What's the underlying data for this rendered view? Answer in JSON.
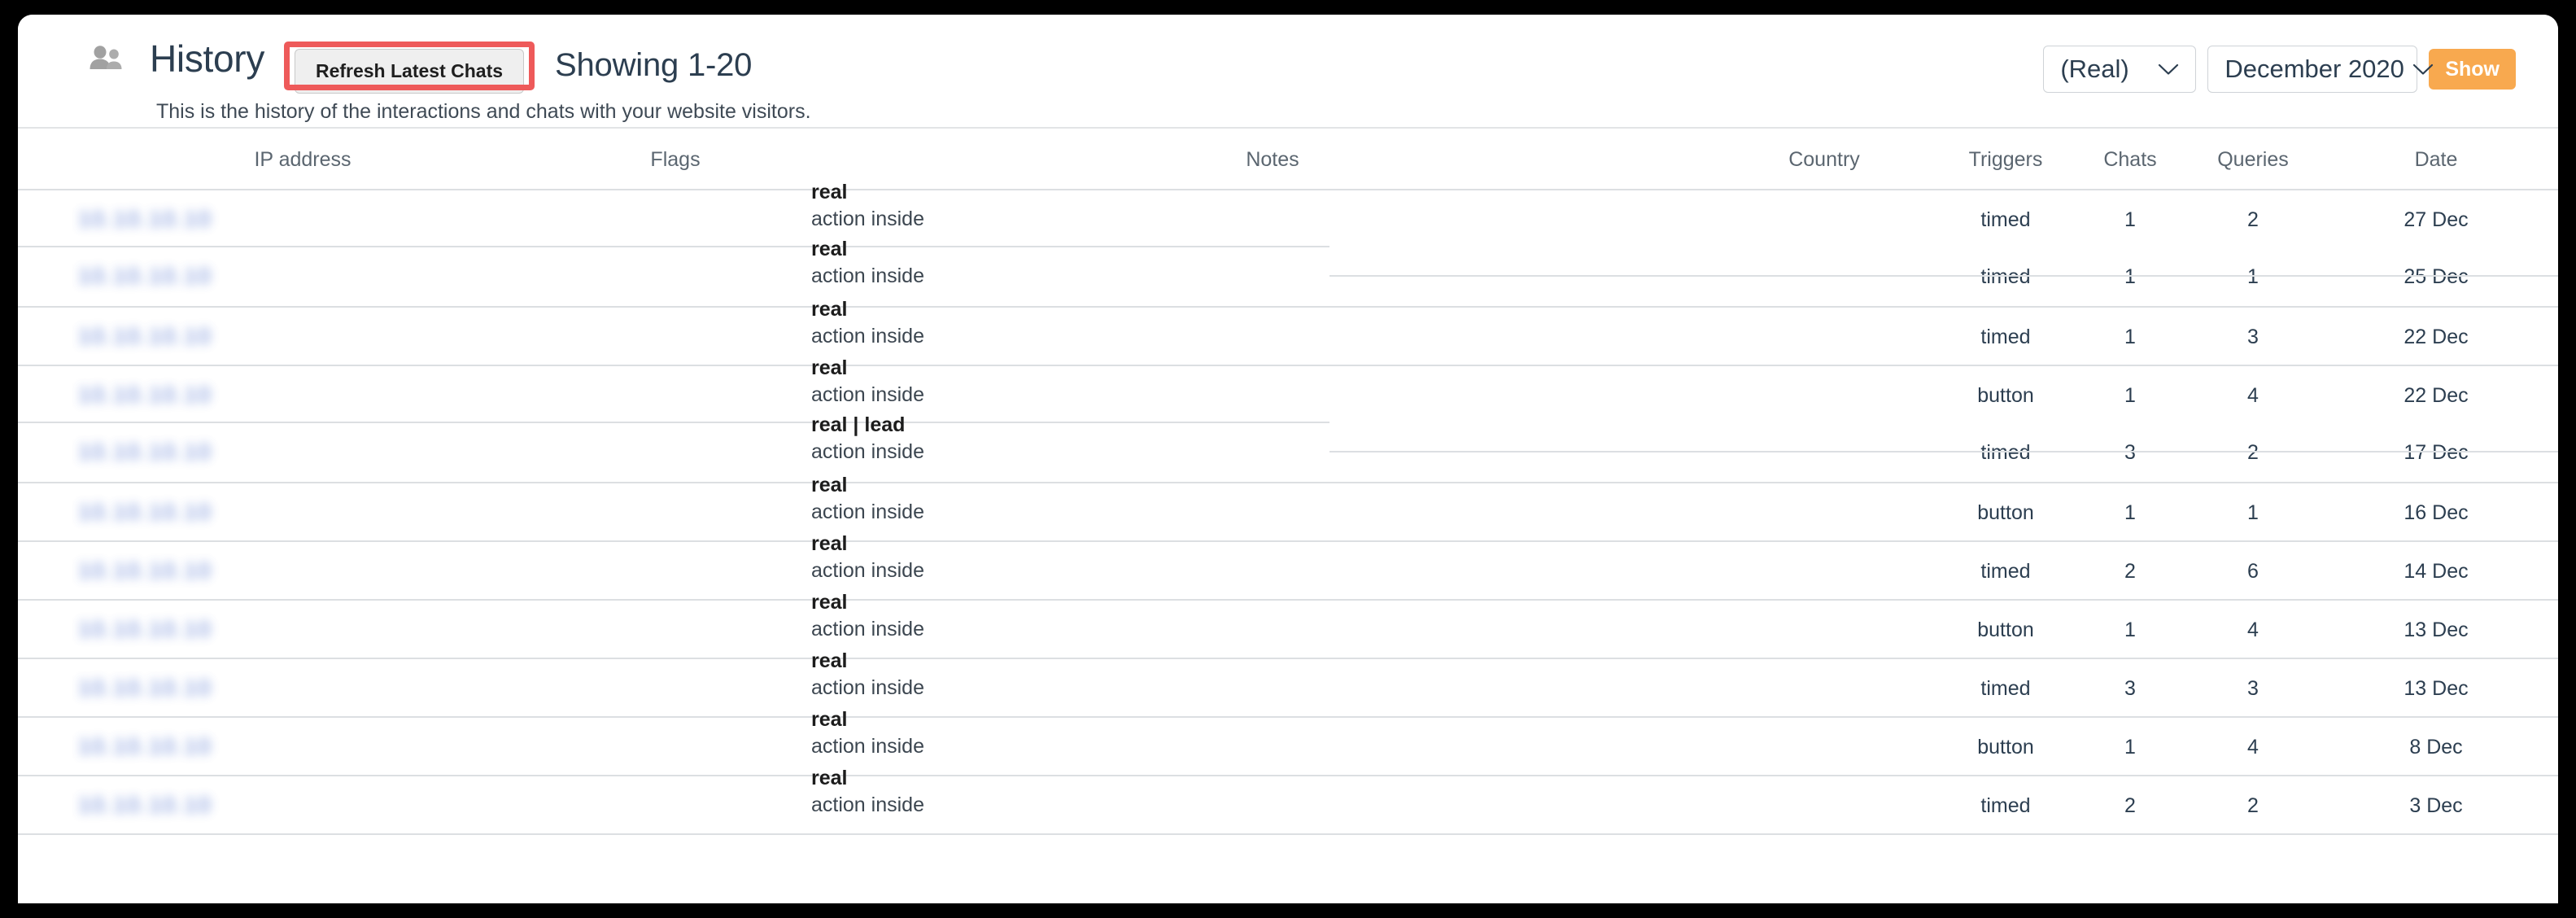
{
  "header": {
    "icon": "people-icon",
    "title": "History",
    "refresh_button": "Refresh Latest Chats",
    "showing": "Showing 1-20",
    "subtitle": "This is the history of the interactions and chats with your website visitors.",
    "highlight_color": "#ee5a5a"
  },
  "controls": {
    "type_select": {
      "value": "(Real)",
      "icon": "chevron-down-icon"
    },
    "month_select": {
      "value": "December 2020",
      "icon": "chevron-down-icon"
    },
    "show_button": {
      "label": "Show",
      "color": "#f8a94f"
    }
  },
  "table": {
    "columns": [
      {
        "key": "ip",
        "label": "IP address"
      },
      {
        "key": "flags",
        "label": "Flags"
      },
      {
        "key": "notes",
        "label": "Notes"
      },
      {
        "key": "country",
        "label": "Country"
      },
      {
        "key": "triggers",
        "label": "Triggers"
      },
      {
        "key": "chats",
        "label": "Chats"
      },
      {
        "key": "queries",
        "label": "Queries"
      },
      {
        "key": "date",
        "label": "Date"
      }
    ],
    "rows": [
      {
        "ip": "10.10.10.10",
        "flag_main": "real",
        "flag_sub": "action inside",
        "notes": "",
        "country": "",
        "triggers": "timed",
        "chats": "1",
        "queries": "2",
        "date": "27 Dec",
        "split_sep": false
      },
      {
        "ip": "10.10.10.10",
        "flag_main": "real",
        "flag_sub": "action inside",
        "notes": "",
        "country": "",
        "triggers": "timed",
        "chats": "1",
        "queries": "1",
        "date": "25 Dec",
        "split_sep": true
      },
      {
        "ip": "10.10.10.10",
        "flag_main": "real",
        "flag_sub": "action inside",
        "notes": "",
        "country": "",
        "triggers": "timed",
        "chats": "1",
        "queries": "3",
        "date": "22 Dec",
        "split_sep": false
      },
      {
        "ip": "10.10.10.10",
        "flag_main": "real",
        "flag_sub": "action inside",
        "notes": "",
        "country": "",
        "triggers": "button",
        "chats": "1",
        "queries": "4",
        "date": "22 Dec",
        "split_sep": false
      },
      {
        "ip": "10.10.10.10",
        "flag_main": "real | lead",
        "flag_sub": "action inside",
        "notes": "",
        "country": "",
        "triggers": "timed",
        "chats": "3",
        "queries": "2",
        "date": "17 Dec",
        "split_sep": true
      },
      {
        "ip": "10.10.10.10",
        "flag_main": "real",
        "flag_sub": "action inside",
        "notes": "",
        "country": "",
        "triggers": "button",
        "chats": "1",
        "queries": "1",
        "date": "16 Dec",
        "split_sep": false
      },
      {
        "ip": "10.10.10.10",
        "flag_main": "real",
        "flag_sub": "action inside",
        "notes": "",
        "country": "",
        "triggers": "timed",
        "chats": "2",
        "queries": "6",
        "date": "14 Dec",
        "split_sep": false
      },
      {
        "ip": "10.10.10.10",
        "flag_main": "real",
        "flag_sub": "action inside",
        "notes": "",
        "country": "",
        "triggers": "button",
        "chats": "1",
        "queries": "4",
        "date": "13 Dec",
        "split_sep": false
      },
      {
        "ip": "10.10.10.10",
        "flag_main": "real",
        "flag_sub": "action inside",
        "notes": "",
        "country": "",
        "triggers": "timed",
        "chats": "3",
        "queries": "3",
        "date": "13 Dec",
        "split_sep": false
      },
      {
        "ip": "10.10.10.10",
        "flag_main": "real",
        "flag_sub": "action inside",
        "notes": "",
        "country": "",
        "triggers": "button",
        "chats": "1",
        "queries": "4",
        "date": "8 Dec",
        "split_sep": false
      },
      {
        "ip": "10.10.10.10",
        "flag_main": "real",
        "flag_sub": "action inside",
        "notes": "",
        "country": "",
        "triggers": "timed",
        "chats": "2",
        "queries": "2",
        "date": "3 Dec",
        "split_sep": false
      }
    ]
  }
}
